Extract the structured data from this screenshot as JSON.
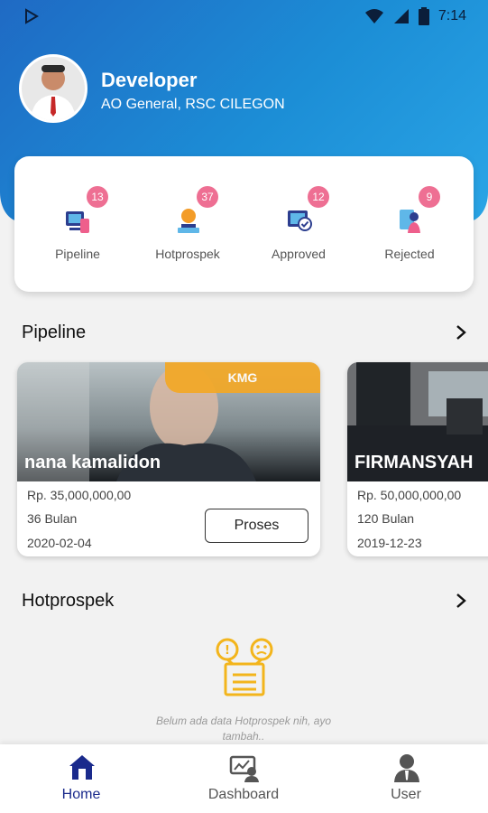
{
  "statusbar": {
    "time": "7:14",
    "play_icon": "play-store-icon",
    "wifi_icon": "wifi-icon",
    "signal_icon": "signal-icon",
    "battery_icon": "battery-icon"
  },
  "profile": {
    "name": "Developer",
    "role": "AO General, RSC CILEGON"
  },
  "summary": [
    {
      "label": "Pipeline",
      "count": "13",
      "icon": "pipeline-icon"
    },
    {
      "label": "Hotprospek",
      "count": "37",
      "icon": "hotprospek-icon"
    },
    {
      "label": "Approved",
      "count": "12",
      "icon": "approved-icon"
    },
    {
      "label": "Rejected",
      "count": "9",
      "icon": "rejected-icon"
    }
  ],
  "sections": {
    "pipeline_title": "Pipeline",
    "hotprospek_title": "Hotprospek"
  },
  "pipeline_cards": [
    {
      "name": "nana kamalidon",
      "tag": "KMG",
      "amount": "Rp. 35,000,000,00",
      "tenor": "36 Bulan",
      "date": "2020-02-04",
      "action": "Proses"
    },
    {
      "name": "FIRMANSYAH",
      "amount": "Rp. 50,000,000,00",
      "tenor": "120 Bulan",
      "date": "2019-12-23"
    }
  ],
  "hotprospek_empty": "Belum ada data Hotprospek nih, ayo tambah..",
  "nav": [
    {
      "label": "Home",
      "icon": "home-icon",
      "active": true
    },
    {
      "label": "Dashboard",
      "icon": "dashboard-icon",
      "active": false
    },
    {
      "label": "User",
      "icon": "user-icon",
      "active": false
    }
  ],
  "colors": {
    "header_start": "#1f6ac4",
    "header_end": "#2aa5e6",
    "badge": "#ee6f93",
    "tag": "#f3a825",
    "nav_active": "#1a2a8c",
    "nav_inactive": "#555555"
  }
}
